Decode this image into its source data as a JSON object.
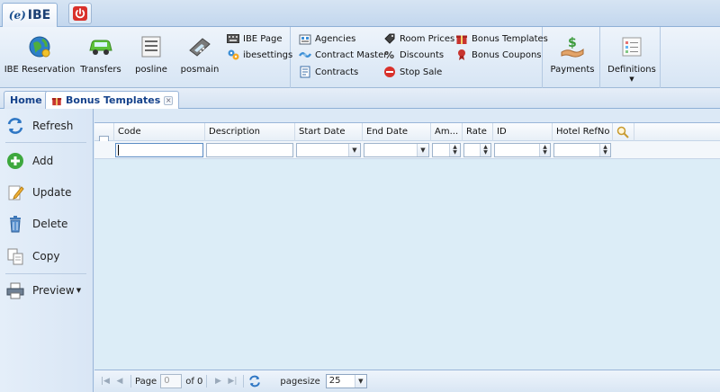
{
  "app": {
    "tab_label": "IBE",
    "logo_mark": "(e)"
  },
  "ribbon": {
    "group_main": [
      {
        "label": "IBE Reservation",
        "icon": "globe-icon"
      },
      {
        "label": "Transfers",
        "icon": "car-icon"
      },
      {
        "label": "posline",
        "icon": "list-icon"
      },
      {
        "label": "posmain",
        "icon": "pos-terminal-icon"
      }
    ],
    "group_main_small": [
      {
        "label": "IBE Page",
        "icon": "keyboard-icon"
      },
      {
        "label": "ibesettings",
        "icon": "settings-icon"
      }
    ],
    "group_contracts": [
      {
        "label": "Agencies",
        "icon": "agencies-icon"
      },
      {
        "label": "Contract Master",
        "icon": "contract-master-icon"
      },
      {
        "label": "Contracts",
        "icon": "contracts-icon"
      }
    ],
    "group_prices": [
      {
        "label": "Room Prices",
        "icon": "price-tag-icon"
      },
      {
        "label": "Discounts",
        "icon": "discount-icon"
      },
      {
        "label": "Stop Sale",
        "icon": "stop-icon"
      }
    ],
    "group_bonus": [
      {
        "label": "Bonus Templates",
        "icon": "gift-icon"
      },
      {
        "label": "Bonus Coupons",
        "icon": "coupon-icon"
      }
    ],
    "payments": {
      "label": "Payments",
      "icon": "payment-icon"
    },
    "definitions": {
      "label": "Definitions",
      "icon": "definitions-icon"
    }
  },
  "doc_tabs": [
    {
      "label": "Home"
    },
    {
      "label": "Bonus Templates",
      "close": "×"
    }
  ],
  "side_toolbar": [
    {
      "label": "Refresh",
      "icon": "refresh-icon"
    },
    {
      "label": "Add",
      "icon": "add-icon"
    },
    {
      "label": "Update",
      "icon": "edit-icon"
    },
    {
      "label": "Delete",
      "icon": "trash-icon"
    },
    {
      "label": "Copy",
      "icon": "copy-icon"
    },
    {
      "label": "Preview",
      "icon": "printer-icon"
    }
  ],
  "grid": {
    "columns": [
      "Code",
      "Description",
      "Start Date",
      "End Date",
      "Am...",
      "Rate",
      "ID",
      "Hotel RefNo"
    ],
    "rows": []
  },
  "pager": {
    "page_label": "Page",
    "page_value": "0",
    "of_label": "of 0",
    "pagesize_label": "pagesize",
    "pagesize_value": "25"
  },
  "colors": {
    "accent": "#15428b",
    "grid_bg": "#dcedf7",
    "power": "#d9312b",
    "add": "#3ea83e"
  }
}
